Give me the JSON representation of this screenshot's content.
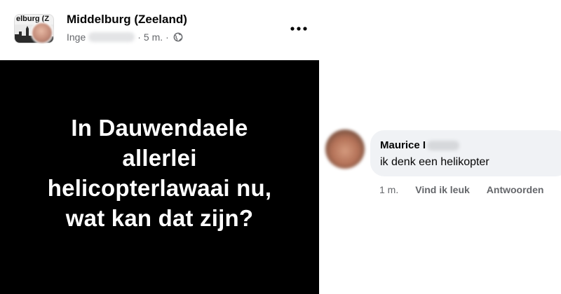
{
  "post": {
    "group_name": "Middelburg (Zeeland)",
    "group_avatar_label": "elburg (Z",
    "author_name": "Inge",
    "timestamp": "5 m.",
    "audience_icon": "globe-icon",
    "more_icon": "more-options-icon",
    "text_lines": [
      "In Dauwendaele",
      "allerlei",
      "helicopterlawaai nu,",
      "wat kan dat zijn?"
    ],
    "background_color": "#000000",
    "text_color": "#ffffff"
  },
  "comment": {
    "author_name": "Maurice I",
    "text": "ik denk een helikopter",
    "time": "1 m.",
    "actions": [
      "Vind ik leuk",
      "Antwoorden"
    ],
    "bubble_color": "#f0f2f5",
    "meta_color": "#65676b"
  }
}
